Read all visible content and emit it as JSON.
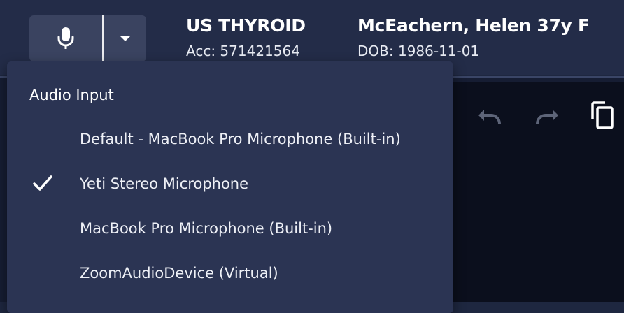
{
  "study": {
    "name": "US THYROID",
    "accession": "Acc: 571421564"
  },
  "patient": {
    "name_age_sex": "McEachern, Helen 37y F",
    "dob": "DOB: 1986-11-01"
  },
  "mic_button": {
    "icon": "microphone-icon",
    "dropdown_icon": "caret-down-icon"
  },
  "audio_menu": {
    "header": "Audio Input",
    "items": [
      {
        "label": "Default - MacBook Pro Microphone (Built-in)",
        "selected": false
      },
      {
        "label": "Yeti Stereo Microphone",
        "selected": true
      },
      {
        "label": "MacBook Pro Microphone (Built-in)",
        "selected": false
      },
      {
        "label": "ZoomAudioDevice (Virtual)",
        "selected": false
      }
    ]
  },
  "editor_toolbar": {
    "icons": [
      "undo-icon",
      "redo-icon",
      "copy-icon"
    ]
  },
  "colors": {
    "header_bg": "#232c48",
    "menu_bg": "#2b3453",
    "button_bg": "#3a4360",
    "editor_bg": "#0b0f1d"
  }
}
